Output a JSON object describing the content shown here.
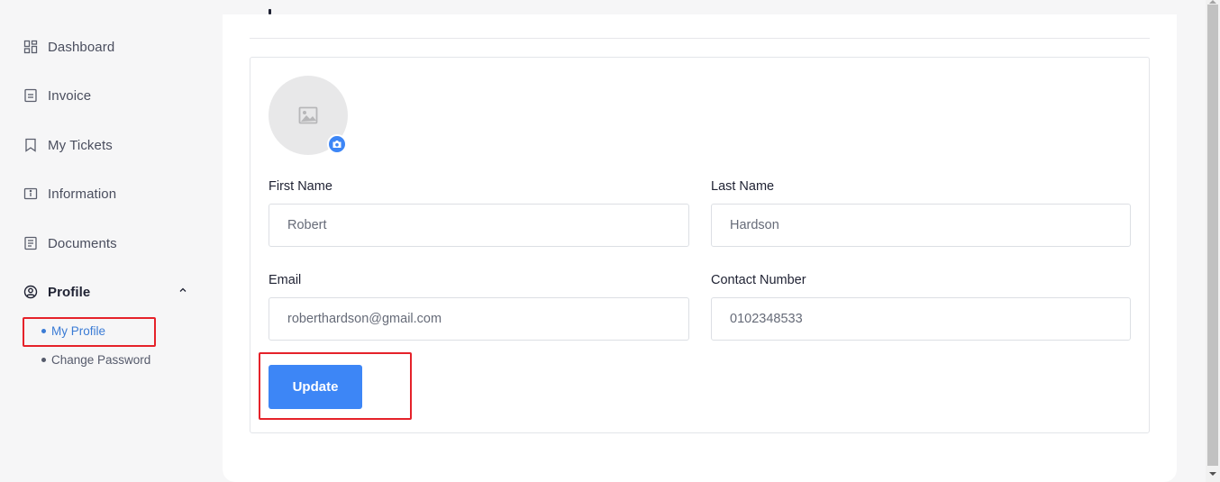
{
  "sidebar": {
    "items": [
      {
        "label": "Dashboard",
        "icon": "dashboard-icon"
      },
      {
        "label": "Invoice",
        "icon": "invoice-icon"
      },
      {
        "label": "My Tickets",
        "icon": "bookmark-icon"
      },
      {
        "label": "Information",
        "icon": "info-icon"
      },
      {
        "label": "Documents",
        "icon": "document-icon"
      },
      {
        "label": "Profile",
        "icon": "user-circle-icon"
      }
    ],
    "profile_submenu": [
      {
        "label": "My Profile"
      },
      {
        "label": "Change Password"
      }
    ]
  },
  "profile_form": {
    "first_name": {
      "label": "First Name",
      "value": "Robert"
    },
    "last_name": {
      "label": "Last Name",
      "value": "Hardson"
    },
    "email": {
      "label": "Email",
      "value": "roberthardson@gmail.com"
    },
    "contact_number": {
      "label": "Contact Number",
      "value": "0102348533"
    },
    "update_label": "Update"
  },
  "colors": {
    "accent": "#3d86f6",
    "highlight": "#e5222a",
    "active_link": "#3a7bd5"
  }
}
